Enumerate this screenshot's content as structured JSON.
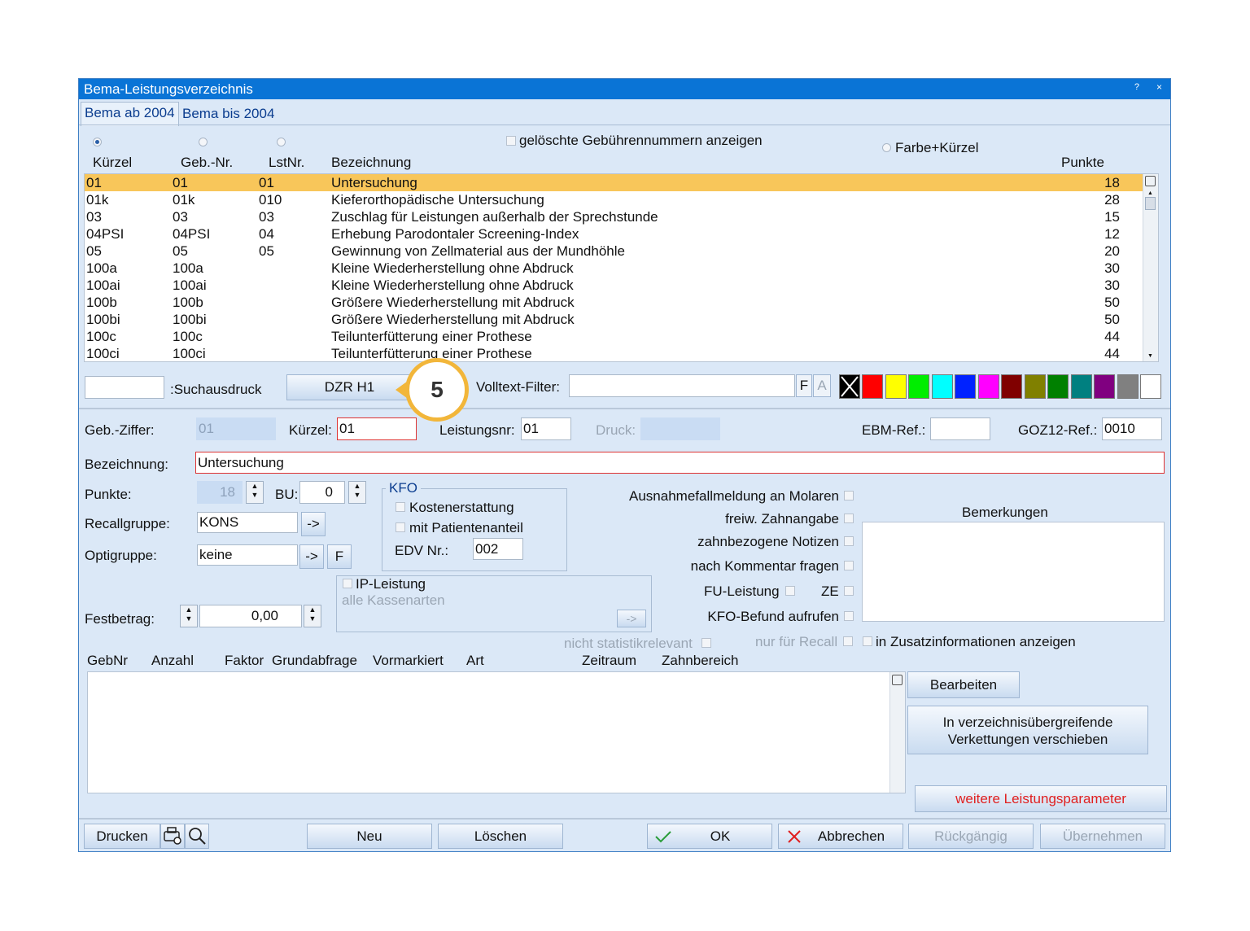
{
  "window": {
    "title": "Bema-Leistungsverzeichnis",
    "help": "?",
    "close": "×"
  },
  "tabs": [
    {
      "label": "Bema ab 2004"
    },
    {
      "label": "Bema bis 2004"
    }
  ],
  "options": {
    "deleted_label": "gelöschte Gebührennummern anzeigen",
    "color_label": "Farbe+Kürzel"
  },
  "list": {
    "headers": {
      "kuerzel": "Kürzel",
      "geb_nr": "Geb.-Nr.",
      "lst_nr": "LstNr.",
      "bezeichnung": "Bezeichnung",
      "punkte": "Punkte"
    },
    "rows": [
      {
        "kuerzel": "01",
        "geb": "01",
        "lst": "01",
        "bez": "Untersuchung",
        "punkte": "18"
      },
      {
        "kuerzel": "01k",
        "geb": "01k",
        "lst": "010",
        "bez": "Kieferorthopädische Untersuchung",
        "punkte": "28"
      },
      {
        "kuerzel": "03",
        "geb": "03",
        "lst": "03",
        "bez": "Zuschlag für Leistungen außerhalb der Sprechstunde",
        "punkte": "15"
      },
      {
        "kuerzel": "04PSI",
        "geb": "04PSI",
        "lst": "04",
        "bez": "Erhebung Parodontaler Screening-Index",
        "punkte": "12"
      },
      {
        "kuerzel": "05",
        "geb": "05",
        "lst": "05",
        "bez": "Gewinnung von Zellmaterial aus der Mundhöhle",
        "punkte": "20"
      },
      {
        "kuerzel": "100a",
        "geb": "100a",
        "lst": "",
        "bez": "Kleine Wiederherstellung ohne Abdruck",
        "punkte": "30"
      },
      {
        "kuerzel": "100ai",
        "geb": "100ai",
        "lst": "",
        "bez": "Kleine Wiederherstellung ohne Abdruck",
        "punkte": "30"
      },
      {
        "kuerzel": "100b",
        "geb": "100b",
        "lst": "",
        "bez": "Größere Wiederherstellung mit Abdruck",
        "punkte": "50"
      },
      {
        "kuerzel": "100bi",
        "geb": "100bi",
        "lst": "",
        "bez": "Größere Wiederherstellung mit Abdruck",
        "punkte": "50"
      },
      {
        "kuerzel": "100c",
        "geb": "100c",
        "lst": "",
        "bez": "Teilunterfütterung einer Prothese",
        "punkte": "44"
      },
      {
        "kuerzel": "100ci",
        "geb": "100ci",
        "lst": "",
        "bez": "Teilunterfütterung einer Prothese",
        "punkte": "44"
      }
    ]
  },
  "search": {
    "label": ":Suchausdruck",
    "dzr_button": "DZR H1",
    "callout": "5",
    "volltext_label": "Volltext-Filter:",
    "f_btn": "F",
    "a_btn": "A"
  },
  "swatches": [
    "#000000",
    "#ff0000",
    "#ffff00",
    "#00ee00",
    "#00ffff",
    "#0022ff",
    "#ff00ff",
    "#800000",
    "#808000",
    "#008000",
    "#008080",
    "#800080",
    "#808080",
    "#ffffff"
  ],
  "form": {
    "geb_ziffer_label": "Geb.-Ziffer:",
    "geb_ziffer_value": "01",
    "kuerzel_label": "Kürzel:",
    "kuerzel_value": "01",
    "leistungsnr_label": "Leistungsnr:",
    "leistungsnr_value": "01",
    "druck_label": "Druck:",
    "ebm_label": "EBM-Ref.:",
    "ebm_value": "",
    "goz_label": "GOZ12-Ref.:",
    "goz_value": "0010",
    "bez_label": "Bezeichnung:",
    "bez_value": "Untersuchung",
    "punkte_label": "Punkte:",
    "punkte_value": "18",
    "bu_label": "BU:",
    "bu_value": "0",
    "recall_label": "Recallgruppe:",
    "recall_value": "KONS",
    "opti_label": "Optigruppe:",
    "opti_value": "keine",
    "arrow_btn": "->",
    "f_btn": "F",
    "fest_label": "Festbetrag:",
    "fest_value": "0,00"
  },
  "kfo": {
    "legend": "KFO",
    "kosten": "Kostenerstattung",
    "patient": "mit Patientenanteil",
    "edv_label": "EDV Nr.:",
    "edv_value": "002"
  },
  "ip": {
    "label": "IP-Leistung",
    "kassen": "alle Kassenarten",
    "arrow": "->"
  },
  "flags": {
    "ausnahme": "Ausnahmefallmeldung an Molaren",
    "freiw": "freiw. Zahnangabe",
    "zahnbez": "zahnbezogene Notizen",
    "kommentar": "nach Kommentar fragen",
    "fu": "FU-Leistung",
    "ze": "ZE",
    "kfo_befund": "KFO-Befund aufrufen",
    "nicht_stat": "nicht statistikrelevant",
    "nur_recall": "nur für Recall",
    "zusatz": "in Zusatzinformationen anzeigen"
  },
  "bemerkungen": {
    "label": "Bemerkungen",
    "value": ""
  },
  "table2": {
    "headers": {
      "gebnr": "GebNr",
      "anzahl": "Anzahl",
      "faktor": "Faktor",
      "grundabfrage": "Grundabfrage",
      "vormarkiert": "Vormarkiert",
      "art": "Art",
      "zeitraum": "Zeitraum",
      "zahnbereich": "Zahnbereich"
    }
  },
  "side_buttons": {
    "bearbeiten": "Bearbeiten",
    "verkettungen_1": "In verzeichnisübergreifende",
    "verkettungen_2": "Verkettungen verschieben",
    "weitere": "weitere Leistungsparameter"
  },
  "footer": {
    "drucken": "Drucken",
    "neu": "Neu",
    "loeschen": "Löschen",
    "ok": "OK",
    "abbrechen": "Abbrechen",
    "rueckgaengig": "Rückgängig",
    "uebernehmen": "Übernehmen"
  }
}
